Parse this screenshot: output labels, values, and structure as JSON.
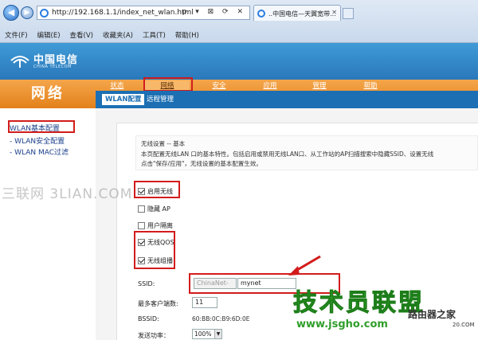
{
  "browser": {
    "url": "http://192.168.1.1/index_net_wlan.html",
    "addr_tools": "ρ ▾ ⊠ ⟳ ✕",
    "tab_title": "..中国电信—天翼宽带...",
    "tab_close": "✕",
    "menu": [
      "文件(F)",
      "编辑(E)",
      "查看(V)",
      "收藏夹(A)",
      "工具(T)",
      "帮助(H)"
    ]
  },
  "brand": {
    "name": "中国电信",
    "sub": "CHINA TELECOM"
  },
  "page": {
    "section_title": "网络"
  },
  "nav": {
    "tabs": [
      "状态",
      "网络",
      "安全",
      "应用",
      "管理",
      "帮助"
    ],
    "active": "网络"
  },
  "subnav": {
    "items": [
      "WLAN配置",
      "远程管理"
    ],
    "active": "WLAN配置"
  },
  "sidebar": {
    "items": [
      "WLAN基本配置",
      "- WLAN安全配置",
      "- WLAN MAC过滤"
    ],
    "active": "WLAN基本配置"
  },
  "intro": {
    "lines": [
      "无线设置 -- 基本",
      "本页配置无线LAN 口的基本特性。包括启用或禁用无线LAN口、从工作站的AP扫描搜索中隐藏SSID、设置无线",
      "点击\"保存/应用\"，无线设置的基本配置生效。"
    ]
  },
  "options": [
    {
      "label": "启用无线",
      "checked": true
    },
    {
      "label": "隐藏 AP",
      "checked": false
    },
    {
      "label": "用户隔离",
      "checked": false
    },
    {
      "label": "无线QOS",
      "checked": true
    },
    {
      "label": "无线组播",
      "checked": true
    }
  ],
  "form": {
    "ssid_label": "SSID:",
    "ssid_prefix": "ChinaNet-",
    "ssid_value": "mynet",
    "max_clients_label": "最多客户端数:",
    "max_clients_value": "11",
    "bssid_label": "BSSID:",
    "bssid_value": "60:BB:0C:B9:6D:0E",
    "tx_power_label": "发送功率：",
    "tx_power_value": "100%"
  },
  "watermarks": {
    "left": "三联网 3LIAN.COM",
    "brand": "技术员联盟",
    "brand_suffix": "路由器之家",
    "url": "www.jsgho.com",
    "url_suffix": "20.COM"
  },
  "colors": {
    "header_blue": "#2a78bb",
    "orange_bar": "#e3801a",
    "subnav_blue": "#1c6fb3",
    "annotation_red": "#d21c1c",
    "watermark_green": "#3fc236"
  }
}
